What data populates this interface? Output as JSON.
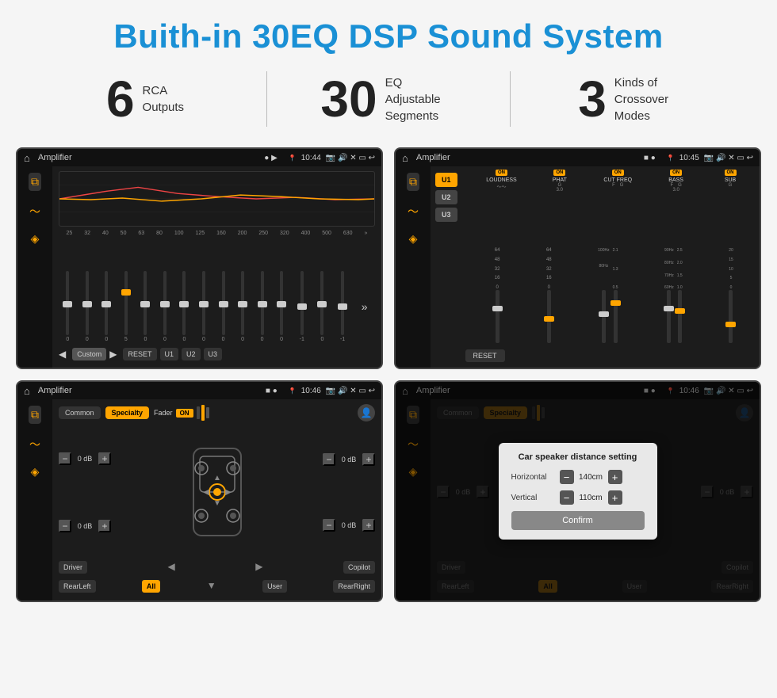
{
  "page": {
    "title": "Buith-in 30EQ DSP Sound System",
    "stats": [
      {
        "number": "6",
        "label": "RCA\nOutputs"
      },
      {
        "number": "30",
        "label": "EQ Adjustable\nSegments"
      },
      {
        "number": "3",
        "label": "Kinds of\nCrossover Modes"
      }
    ]
  },
  "screens": {
    "eq1": {
      "title": "Amplifier",
      "time": "10:44",
      "eq_freqs": [
        "25",
        "32",
        "40",
        "50",
        "63",
        "80",
        "100",
        "125",
        "160",
        "200",
        "250",
        "320",
        "400",
        "500",
        "630"
      ],
      "eq_values": [
        "0",
        "0",
        "0",
        "5",
        "0",
        "0",
        "0",
        "0",
        "0",
        "0",
        "0",
        "0",
        "-1",
        "0",
        "-1"
      ],
      "bottom_buttons": [
        "Custom",
        "RESET",
        "U1",
        "U2",
        "U3"
      ]
    },
    "eq2": {
      "title": "Amplifier",
      "time": "10:45",
      "presets": [
        "U1",
        "U2",
        "U3"
      ],
      "channels": [
        "LOUDNESS",
        "PHAT",
        "CUT FREQ",
        "BASS",
        "SUB"
      ]
    },
    "speaker1": {
      "title": "Amplifier",
      "time": "10:46",
      "tabs": [
        "Common",
        "Specialty"
      ],
      "active_tab": "Specialty",
      "fader_label": "Fader",
      "fader_on": "ON",
      "db_values": [
        "0 dB",
        "0 dB",
        "0 dB",
        "0 dB"
      ],
      "bottom_buttons": [
        "Driver",
        "",
        "Copilot",
        "RearLeft",
        "All",
        "User",
        "RearRight"
      ]
    },
    "speaker2": {
      "title": "Amplifier",
      "time": "10:46",
      "tabs": [
        "Common",
        "Specialty"
      ],
      "dialog": {
        "title": "Car speaker distance setting",
        "horizontal_label": "Horizontal",
        "horizontal_value": "140cm",
        "vertical_label": "Vertical",
        "vertical_value": "110cm",
        "confirm_label": "Confirm"
      },
      "db_values": [
        "0 dB",
        "0 dB"
      ],
      "bottom_buttons": [
        "Driver",
        "Copilot",
        "RearLeft",
        "User",
        "RearRight"
      ]
    }
  }
}
